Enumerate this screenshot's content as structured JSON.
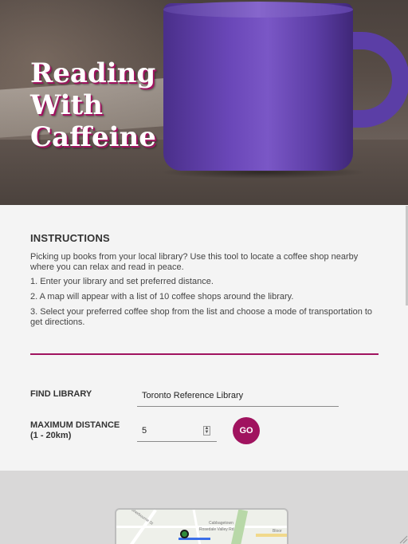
{
  "hero": {
    "title_line1": "Reading",
    "title_line2": "With",
    "title_line3": "Caffeine"
  },
  "instructions": {
    "heading": "INSTRUCTIONS",
    "intro": "Picking up books from your local library? Use this tool to locate a coffee shop nearby where you can relax and read in peace.",
    "step1": "1. Enter your library and set preferred distance.",
    "step2": "2. A map will appear with a list of 10 coffee shops around the library.",
    "step3": "3. Select your preferred coffee shop from the list and choose a mode of transportation to get directions."
  },
  "form": {
    "find_label": "FIND LIBRARY",
    "library_value": "Toronto Reference Library",
    "distance_label_line1": "MAXIMUM DISTANCE",
    "distance_label_line2": "(1 - 20km)",
    "distance_value": "5",
    "go_label": "GO"
  },
  "map": {
    "label_street1": "Sherbourne St",
    "label_street2": "Rosedale Valley Rd",
    "label_area": "Cabbagetown",
    "label_place": "Bloor"
  },
  "colors": {
    "accent": "#a0135f",
    "mug": "#6a47b8"
  }
}
